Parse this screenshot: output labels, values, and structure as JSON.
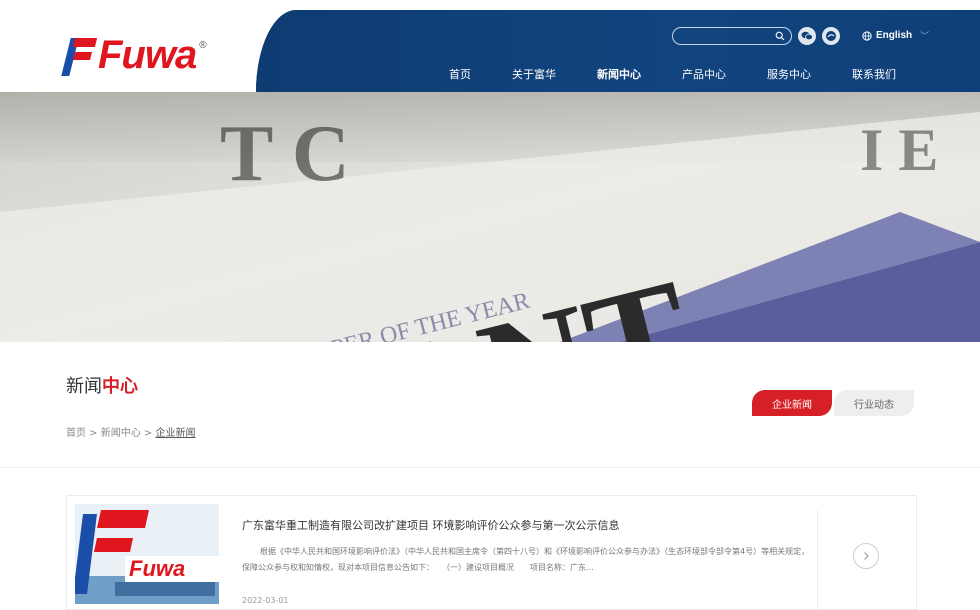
{
  "brand": {
    "logo_text": "Fuwa",
    "registered": "®"
  },
  "header": {
    "search_placeholder": "",
    "language": "English",
    "nav": [
      {
        "label": "首页"
      },
      {
        "label": "关于富华"
      },
      {
        "label": "新闻中心"
      },
      {
        "label": "产品中心"
      },
      {
        "label": "服务中心"
      },
      {
        "label": "联系我们"
      }
    ],
    "active_nav": "新闻中心"
  },
  "banner": {
    "text_upper": "EUROPEAN NEWSPAPER OF THE YEAR",
    "text_big": "OURANT",
    "text_top": "T  C",
    "text_right": "I  E"
  },
  "section": {
    "title_plain": "新闻",
    "title_accent": "中心",
    "breadcrumb": {
      "home": "首页",
      "sep": " > ",
      "parent": "新闻中心",
      "current": "企业新闻"
    },
    "tabs": [
      {
        "label": "企业新闻",
        "active": true
      },
      {
        "label": "行业动态",
        "active": false
      }
    ]
  },
  "news": [
    {
      "title": "广东富华重工制造有限公司改扩建项目 环境影响评价公众参与第一次公示信息",
      "summary": "根据《中华人民共和国环境影响评价法》（中华人民共和国主席令（第四十八号）和《环境影响评价公众参与办法》（生态环境部令部令第4号）等相关规定，保障公众参与权和知情权，现对本项目信息公告如下：　　（一）建设项目概况　　项目名称：广东...",
      "date": "2022-03-01",
      "thumb_logo_text": "Fuwa"
    }
  ],
  "colors": {
    "brand_red": "#d61f26",
    "brand_blue": "#0f3f78",
    "logo_blue": "#1a4ea8"
  }
}
